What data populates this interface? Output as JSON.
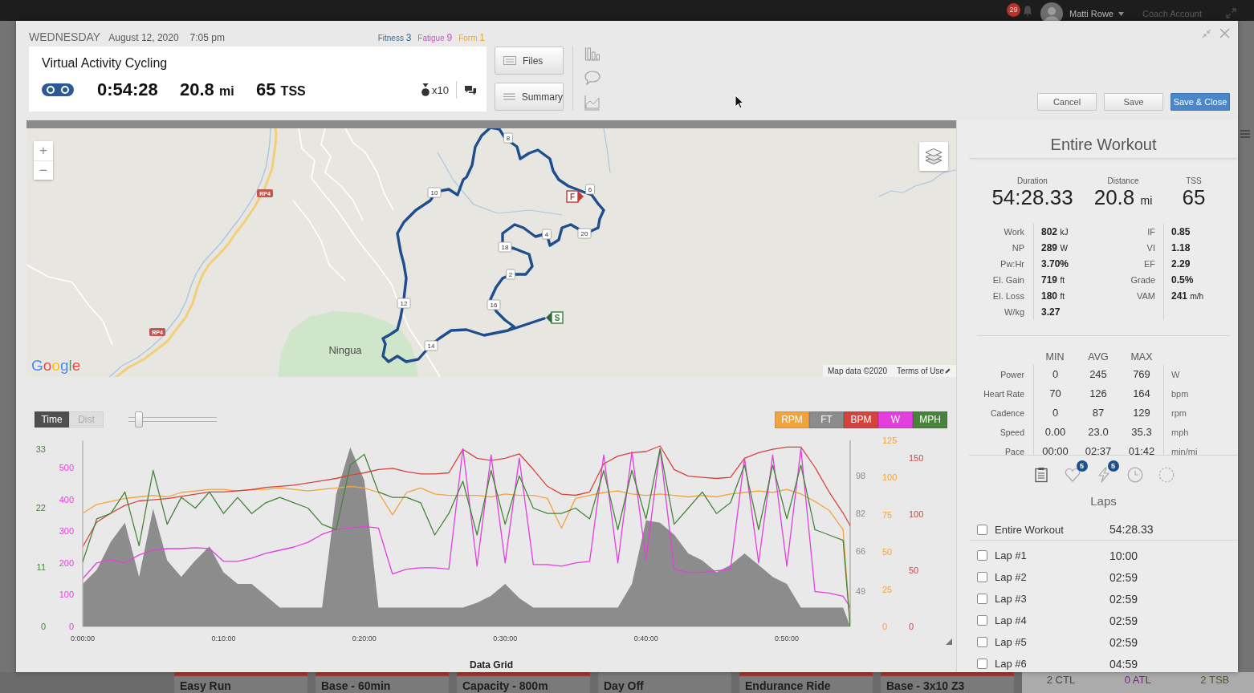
{
  "top_bar": {
    "notifications": "29",
    "user_name": "Matti Rowe",
    "account": "Coach Account"
  },
  "header": {
    "day": "WEDNESDAY",
    "date": "August 12, 2020",
    "time": "7:05 pm",
    "training_load": [
      {
        "label": "Fitness",
        "value": "3",
        "color": "#3c6f8f"
      },
      {
        "label": "Fatigue",
        "value": "9",
        "color": "#d64fc8"
      },
      {
        "label": "Form",
        "value": "1",
        "color": "#f2a526"
      }
    ],
    "activity": {
      "title": "Virtual Activity Cycling",
      "duration": "0:54:28",
      "distance": "20.8",
      "distance_unit": "mi",
      "tss": "65",
      "tss_unit": "TSS",
      "medals": "x10"
    },
    "side_buttons": [
      "Files",
      "Summary"
    ],
    "actions": [
      {
        "label": "Cancel",
        "kind": "default"
      },
      {
        "label": "Save",
        "kind": "default"
      },
      {
        "label": "Save & Close",
        "kind": "primary"
      }
    ]
  },
  "map": {
    "zoom_in": "+",
    "zoom_out": "−",
    "markers": [
      {
        "label": "8",
        "kind": "distance"
      },
      {
        "label": "10",
        "kind": "distance"
      },
      {
        "label": "6",
        "kind": "distance"
      },
      {
        "label": "F",
        "kind": "finish"
      },
      {
        "label": "4",
        "kind": "distance"
      },
      {
        "label": "20",
        "kind": "distance"
      },
      {
        "label": "18",
        "kind": "distance"
      },
      {
        "label": "2",
        "kind": "distance"
      },
      {
        "label": "12",
        "kind": "distance"
      },
      {
        "label": "16",
        "kind": "distance"
      },
      {
        "label": "S",
        "kind": "start"
      },
      {
        "label": "14",
        "kind": "distance"
      }
    ],
    "road_labels": [
      "RP4",
      "RP4"
    ],
    "place_label": "Ningua",
    "logo": "Google",
    "attribution": "Map data ©2020",
    "terms": "Terms of Use"
  },
  "chart": {
    "range_toggle": [
      {
        "label": "Time",
        "selected": true
      },
      {
        "label": "Dist",
        "selected": false
      }
    ],
    "zoom_slider": {
      "level": 0.12
    },
    "layers": [
      {
        "chart_data": {
          "type": "line",
          "x": [
            0,
            1,
            2,
            3,
            4,
            5,
            6,
            7,
            8,
            9,
            10,
            11,
            12,
            13,
            14,
            15,
            16,
            17,
            18,
            19,
            20,
            21,
            22,
            23,
            24,
            25,
            26,
            27,
            28,
            29,
            30,
            31,
            32,
            33,
            34,
            35,
            36,
            37,
            38,
            39,
            40,
            41,
            42,
            43,
            44,
            45,
            46,
            47,
            48,
            49,
            50,
            51,
            52,
            53,
            54,
            54.5
          ],
          "xlim": [
            0,
            54.5
          ],
          "xticks": [
            {
              "value": 0,
              "label": "0:00:00"
            },
            {
              "value": 10,
              "label": "0:10:00"
            },
            {
              "value": 20,
              "label": "0:20:00"
            },
            {
              "value": 30,
              "label": "0:30:00"
            },
            {
              "value": 40,
              "label": "0:40:00"
            },
            {
              "value": 50,
              "label": "0:50:00"
            }
          ],
          "ylim": [
            0,
            125
          ],
          "yticks": [
            0,
            25,
            50,
            75,
            100,
            125
          ],
          "series": [
            {
              "name": "RPM",
              "color": "#f2a33c",
              "values": [
                76,
                82,
                84,
                86,
                87,
                88,
                87,
                90,
                91,
                92,
                92,
                91,
                92,
                92,
                93,
                92,
                91,
                92,
                93,
                94,
                93,
                90,
                75,
                90,
                93,
                89,
                88,
                88,
                88,
                87,
                89,
                88,
                88,
                86,
                66,
                86,
                88,
                90,
                91,
                89,
                88,
                89,
                88,
                87,
                88,
                87,
                89,
                90,
                91,
                90,
                92,
                89,
                84,
                78,
                65,
                0
              ]
            }
          ]
        }
      },
      {
        "chart_data": {
          "type": "area",
          "x": [
            0,
            1,
            2,
            3,
            4,
            5,
            6,
            7,
            8,
            9,
            10,
            11,
            12,
            13,
            14,
            15,
            16,
            17,
            18,
            19,
            20,
            21,
            22,
            23,
            24,
            25,
            26,
            27,
            28,
            29,
            30,
            31,
            32,
            33,
            34,
            35,
            36,
            37,
            38,
            39,
            40,
            41,
            42,
            43,
            44,
            45,
            46,
            47,
            48,
            49,
            50,
            51,
            52,
            53,
            54,
            54.5
          ],
          "xlim": [
            0,
            54.5
          ],
          "ylim": [
            34,
            113
          ],
          "yticks": [
            49,
            66,
            82,
            98
          ],
          "series": [
            {
              "name": "FT",
              "color": "#8c8c8c",
              "values": [
                52,
                58,
                70,
                78,
                55,
                84,
                62,
                55,
                62,
                68,
                57,
                52,
                52,
                47,
                42,
                42,
                42,
                42,
                90,
                110,
                96,
                42,
                42,
                42,
                42,
                42,
                42,
                42,
                44,
                47,
                52,
                46,
                42,
                42,
                42,
                42,
                42,
                42,
                42,
                52,
                79,
                78,
                73,
                65,
                62,
                57,
                60,
                65,
                60,
                55,
                52,
                42,
                42,
                42,
                42,
                34
              ]
            }
          ]
        }
      },
      {
        "chart_data": {
          "type": "line",
          "x": [
            0,
            1,
            2,
            3,
            4,
            5,
            6,
            7,
            8,
            9,
            10,
            11,
            12,
            13,
            14,
            15,
            16,
            17,
            18,
            19,
            20,
            21,
            22,
            23,
            24,
            25,
            26,
            27,
            28,
            29,
            30,
            31,
            32,
            33,
            34,
            35,
            36,
            37,
            38,
            39,
            40,
            41,
            42,
            43,
            44,
            45,
            46,
            47,
            48,
            49,
            50,
            51,
            52,
            53,
            54,
            54.5
          ],
          "xlim": [
            0,
            54.5
          ],
          "ylim": [
            0,
            166
          ],
          "yticks": [
            0,
            50,
            100,
            150
          ],
          "series": [
            {
              "name": "BPM",
              "color": "#d8423d",
              "values": [
                71,
                93,
                101,
                108,
                112,
                113,
                114,
                116,
                118,
                120,
                120,
                121,
                122,
                124,
                125,
                126,
                128,
                130,
                132,
                135,
                137,
                140,
                141,
                138,
                136,
                136,
                137,
                158,
                150,
                148,
                150,
                154,
                140,
                125,
                118,
                117,
                120,
                145,
                152,
                155,
                156,
                161,
                140,
                134,
                133,
                132,
                133,
                150,
                155,
                158,
                160,
                160,
                142,
                120,
                101,
                90
              ]
            }
          ]
        }
      },
      {
        "chart_data": {
          "type": "line",
          "x": [
            0,
            1,
            2,
            3,
            4,
            5,
            6,
            7,
            8,
            9,
            10,
            11,
            12,
            13,
            14,
            15,
            16,
            17,
            18,
            19,
            20,
            21,
            22,
            23,
            24,
            25,
            26,
            27,
            28,
            29,
            30,
            31,
            32,
            33,
            34,
            35,
            36,
            37,
            38,
            39,
            40,
            41,
            42,
            43,
            44,
            45,
            46,
            47,
            48,
            49,
            50,
            51,
            52,
            53,
            54,
            54.5
          ],
          "xlim": [
            0,
            54.5
          ],
          "ylim": [
            0,
            586
          ],
          "yticks": [
            0,
            100,
            200,
            300,
            400,
            500
          ],
          "series": [
            {
              "name": "W",
              "color": "#e33fdc",
              "values": [
                150,
                200,
                210,
                200,
                225,
                240,
                245,
                245,
                248,
                245,
                205,
                205,
                215,
                230,
                240,
                250,
                265,
                290,
                305,
                310,
                315,
                310,
                165,
                180,
                185,
                185,
                180,
                560,
                190,
                540,
                200,
                530,
                195,
                195,
                190,
                200,
                205,
                540,
                200,
                550,
                210,
                560,
                180,
                170,
                170,
                175,
                180,
                530,
                200,
                540,
                190,
                560,
                110,
                105,
                95,
                60
              ]
            }
          ]
        }
      },
      {
        "chart_data": {
          "type": "line",
          "x": [
            0,
            1,
            2,
            3,
            4,
            5,
            6,
            7,
            8,
            9,
            10,
            11,
            12,
            13,
            14,
            15,
            16,
            17,
            18,
            19,
            20,
            21,
            22,
            23,
            24,
            25,
            26,
            27,
            28,
            29,
            30,
            31,
            32,
            33,
            34,
            35,
            36,
            37,
            38,
            39,
            40,
            41,
            42,
            43,
            44,
            45,
            46,
            47,
            48,
            49,
            50,
            51,
            52,
            53,
            54,
            54.5
          ],
          "xlim": [
            0,
            54.5
          ],
          "ylim": [
            0,
            34.6
          ],
          "yticks": [
            0,
            11,
            22,
            33
          ],
          "series": [
            {
              "name": "MPH",
              "color": "#46843a",
              "values": [
                12,
                20,
                21,
                25,
                15,
                29,
                19,
                24,
                22,
                25,
                21,
                24,
                21,
                23,
                24,
                23,
                22,
                19,
                18,
                30,
                32,
                25,
                24,
                24,
                23,
                17,
                21,
                27,
                17,
                29,
                19,
                28,
                22,
                21,
                21,
                22,
                20,
                29,
                18,
                29,
                20,
                33,
                19,
                22,
                25,
                21,
                23,
                30,
                18,
                30,
                20,
                30,
                18,
                17,
                16,
                0
              ]
            }
          ]
        }
      }
    ],
    "section_title": "Data Grid"
  },
  "summary_panel": {
    "title": "Entire Workout",
    "headline": [
      {
        "label": "Duration",
        "value": "54:28.33"
      },
      {
        "label": "Distance",
        "value": "20.8",
        "unit": "mi"
      },
      {
        "label": "TSS",
        "value": "65"
      }
    ],
    "metrics_left": [
      {
        "label": "Work",
        "value": "802",
        "unit": "kJ"
      },
      {
        "label": "NP",
        "value": "289",
        "unit": "W"
      },
      {
        "label": "Pw:Hr",
        "value": "3.70%"
      },
      {
        "label": "El. Gain",
        "value": "719",
        "unit": "ft"
      },
      {
        "label": "El. Loss",
        "value": "180",
        "unit": "ft"
      },
      {
        "label": "W/kg",
        "value": "3.27"
      }
    ],
    "metrics_right": [
      {
        "label": "IF",
        "value": "0.85"
      },
      {
        "label": "VI",
        "value": "1.18"
      },
      {
        "label": "EF",
        "value": "2.29"
      },
      {
        "label": "Grade",
        "value": "0.5%"
      },
      {
        "label": "VAM",
        "value": "241",
        "unit": "m/h"
      }
    ],
    "range_table": {
      "columns": [
        "MIN",
        "AVG",
        "MAX"
      ],
      "rows": [
        {
          "label": "Power",
          "min": "0",
          "avg": "245",
          "max": "769",
          "unit": "W"
        },
        {
          "label": "Heart Rate",
          "min": "70",
          "avg": "126",
          "max": "164",
          "unit": "bpm"
        },
        {
          "label": "Cadence",
          "min": "0",
          "avg": "87",
          "max": "129",
          "unit": "rpm"
        },
        {
          "label": "Speed",
          "min": "0.00",
          "avg": "23.0",
          "max": "35.3",
          "unit": "mph"
        },
        {
          "label": "Pace",
          "min": "00:00",
          "avg": "02:37",
          "max": "01:42",
          "unit": "min/mi"
        }
      ]
    },
    "tools": [
      {
        "selected": true
      },
      {
        "badge": "5",
        "selected": false
      },
      {
        "badge": "5",
        "selected": false
      },
      {
        "selected": false
      },
      {
        "selected": false
      }
    ],
    "laps_title": "Laps",
    "entire_workout": {
      "name": "Entire Workout",
      "time": "54:28.33",
      "checked": false
    },
    "laps": [
      {
        "name": "Lap #1",
        "time": "10:00",
        "checked": false
      },
      {
        "name": "Lap #2",
        "time": "02:59",
        "checked": false
      },
      {
        "name": "Lap #3",
        "time": "02:59",
        "checked": false
      },
      {
        "name": "Lap #4",
        "time": "02:59",
        "checked": false
      },
      {
        "name": "Lap #5",
        "time": "02:59",
        "checked": false
      },
      {
        "name": "Lap #6",
        "time": "04:59",
        "checked": false
      }
    ]
  },
  "calendar": [
    {
      "title": "Easy Run",
      "color": "#9b3a33"
    },
    {
      "title": "Base - 60min",
      "color": "#9b3a33"
    },
    {
      "title": "Capacity - 800m",
      "color": "#9b3a33"
    },
    {
      "title": "Day Off"
    },
    {
      "title": "Endurance Ride",
      "color": "#9b3a33"
    },
    {
      "title": "Base - 3x10 Z3",
      "color": "#9b3a33"
    }
  ],
  "week_summary": [
    {
      "label": "2 CTL",
      "color": "#3a4c60"
    },
    {
      "label": "0 ATL",
      "color": "#6e2a6c"
    },
    {
      "label": "2 TSB",
      "color": "#4d5a22"
    }
  ]
}
